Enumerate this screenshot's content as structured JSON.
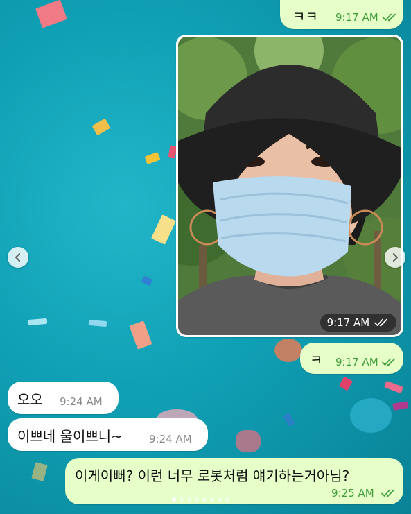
{
  "messages": [
    {
      "text": "ㅋㅋ",
      "time": "9:17 AM"
    },
    {
      "time": "9:17 AM"
    },
    {
      "text": "ㅋ",
      "time": "9:17 AM"
    },
    {
      "text": "오오",
      "time": "9:24 AM"
    },
    {
      "text": "이쁘네 울이쁘니~",
      "time": "9:24 AM"
    },
    {
      "text": "이게이뻐? 이런 너무 로봇처럼 얘기하는거아님?",
      "time": "9:25 AM"
    }
  ],
  "icons": {
    "read_receipt": "double-check-icon",
    "prev": "chevron-left-icon",
    "next": "chevron-right-icon"
  },
  "colors": {
    "outgoing_bubble": "#e6ffc9",
    "incoming_bubble": "#ffffff",
    "outgoing_time": "#3f9e3a",
    "incoming_time": "#8a8a8a",
    "background": "#13a8bb"
  }
}
